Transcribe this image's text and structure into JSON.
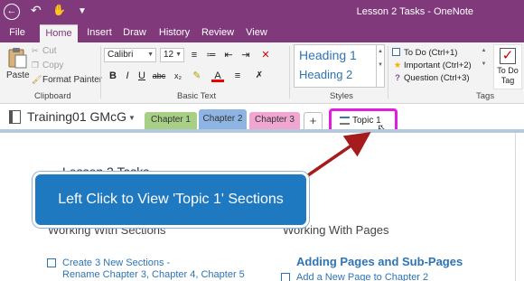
{
  "window": {
    "title": "Lesson 2 Tasks - OneNote"
  },
  "menu_tabs": [
    "File",
    "Home",
    "Insert",
    "Draw",
    "History",
    "Review",
    "View"
  ],
  "clipboard": {
    "paste": "Paste",
    "cut": "Cut",
    "copy": "Copy",
    "format_painter": "Format Painter",
    "group": "Clipboard"
  },
  "basic_text": {
    "font": "Calibri",
    "size": "12",
    "group": "Basic Text",
    "bold": "B",
    "italic": "I",
    "underline": "U",
    "strikethrough": "abc"
  },
  "styles": {
    "heading1": "Heading 1",
    "heading2": "Heading 2",
    "group": "Styles"
  },
  "tags": {
    "items": [
      {
        "label": "To Do (Ctrl+1)"
      },
      {
        "label": "Important (Ctrl+2)"
      },
      {
        "label": "Question (Ctrl+3)"
      }
    ],
    "todo_button": "To Do Tag",
    "group": "Tags"
  },
  "notebook": {
    "name": "Training01 GMcG",
    "sections": [
      {
        "label": "Chapter 1",
        "color": "#a8cf86"
      },
      {
        "label": "Chapter 2",
        "color": "#8db4e2"
      },
      {
        "label": "Chapter 3",
        "color": "#f0a6d1"
      }
    ],
    "add": "+",
    "topic": "Topic 1"
  },
  "page": {
    "title": "Lesson 2 Tasks",
    "col1_heading": "Working With Sections",
    "col2_heading": "Working With Pages",
    "col2_subheading": "Adding Pages and Sub-Pages",
    "task1_line1": "Create 3 New Sections -",
    "task1_line2": "Rename Chapter 3, Chapter 4, Chapter 5",
    "task2": "Add a New Page to Chapter 2"
  },
  "callout": {
    "text": "Left Click to View 'Topic 1' Sections"
  },
  "colors": {
    "accent": "#80397b",
    "highlight": "#e41ce0",
    "callout": "#1e79c1",
    "link": "#2e74b5"
  }
}
